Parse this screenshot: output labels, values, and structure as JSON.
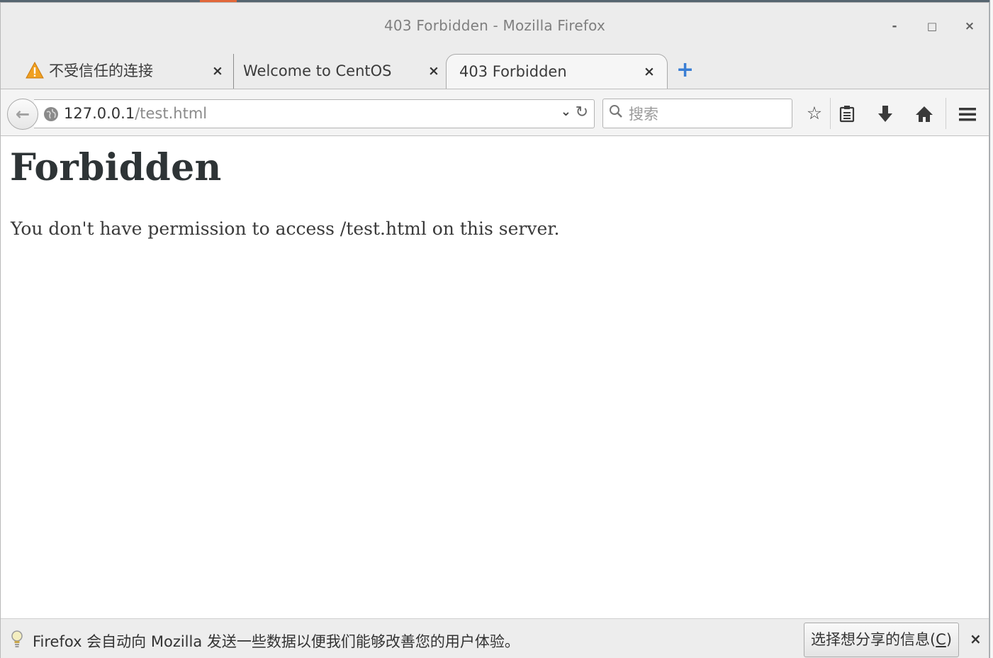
{
  "window": {
    "title": "403 Forbidden - Mozilla Firefox",
    "minimize_glyph": "-",
    "maximize_glyph": "□",
    "close_glyph": "×"
  },
  "tabs": [
    {
      "label": "不受信任的连接",
      "icon": "warning-icon",
      "active": false
    },
    {
      "label": "Welcome to CentOS",
      "icon": "",
      "active": false
    },
    {
      "label": "403 Forbidden",
      "icon": "",
      "active": true
    }
  ],
  "tab_close_glyph": "×",
  "newtab_glyph": "+",
  "navbar": {
    "back_glyph": "←",
    "url_host": "127.0.0.1",
    "url_path": "/test.html",
    "dropdown_glyph": "⌄",
    "reload_glyph": "↻",
    "search_placeholder": "搜索",
    "search_icon_glyph": "⚲",
    "bookmark_glyph": "☆",
    "reading_list_glyph": "▤",
    "download_glyph": "⬇",
    "home_glyph": "⌂",
    "menu_glyph": "≡"
  },
  "page": {
    "heading": "Forbidden",
    "message": "You don't have permission to access /test.html on this server."
  },
  "notification": {
    "text": "Firefox 会自动向 Mozilla 发送一些数据以便我们能够改善您的用户体验。",
    "button_prefix": "选择想分享的信息(",
    "button_accesskey": "C",
    "button_suffix": ")",
    "close_glyph": "×"
  },
  "colors": {
    "accent_blue": "#3a7ed4",
    "warning_orange": "#f0a020"
  }
}
